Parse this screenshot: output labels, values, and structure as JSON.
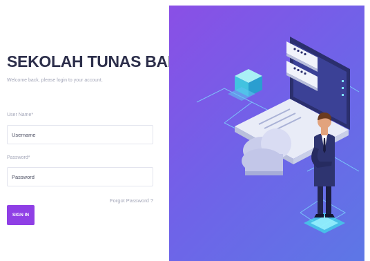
{
  "login": {
    "title": "SEKOLAH TUNAS BANGSA",
    "subtitle": "Welcome back, please login to your account.",
    "username_label": "User Name*",
    "username_placeholder": "Username",
    "password_label": "Password*",
    "password_placeholder": "Password",
    "forgot_label": "Forgot Password ?",
    "signin_label": "SIGN IN"
  },
  "illustration": {
    "name": "security-login-illustration-icon"
  },
  "colors": {
    "accent": "#8f3fe5",
    "title": "#2d2f4b",
    "muted": "#a3a6b8",
    "panel_start": "#8a4fe6",
    "panel_end": "#5d77e6"
  }
}
